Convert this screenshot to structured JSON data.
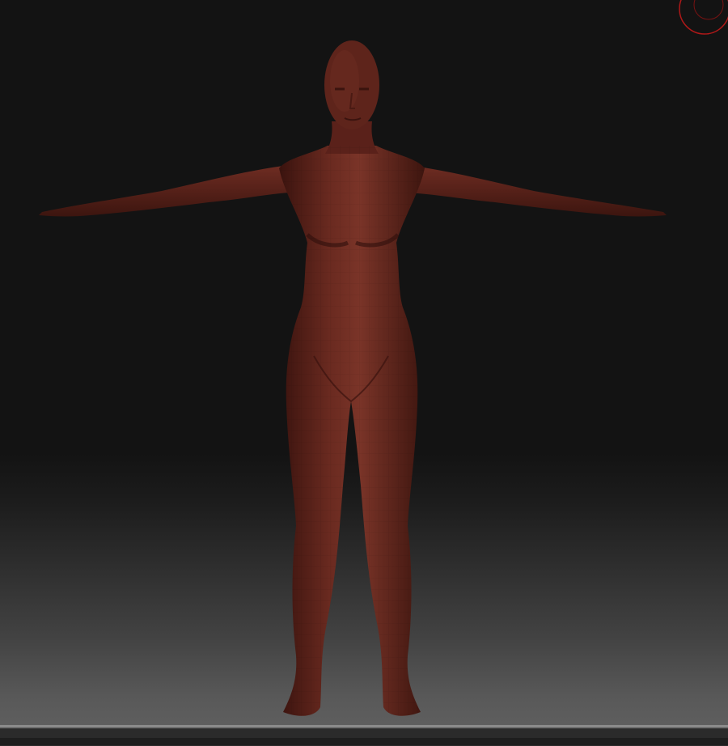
{
  "viewport": {
    "background_top": "#131313",
    "background_bottom": "#5f5f5f",
    "floor_color": "#8a8a8a"
  },
  "model": {
    "name_icon": "human-figure-model",
    "pose": "T-pose",
    "material_color": "#5a211a",
    "highlight_color": "#7a3428",
    "shadow_color": "#3a130e"
  },
  "gyro": {
    "icon": "navigation-gyro-icon",
    "color": "#b01818"
  }
}
